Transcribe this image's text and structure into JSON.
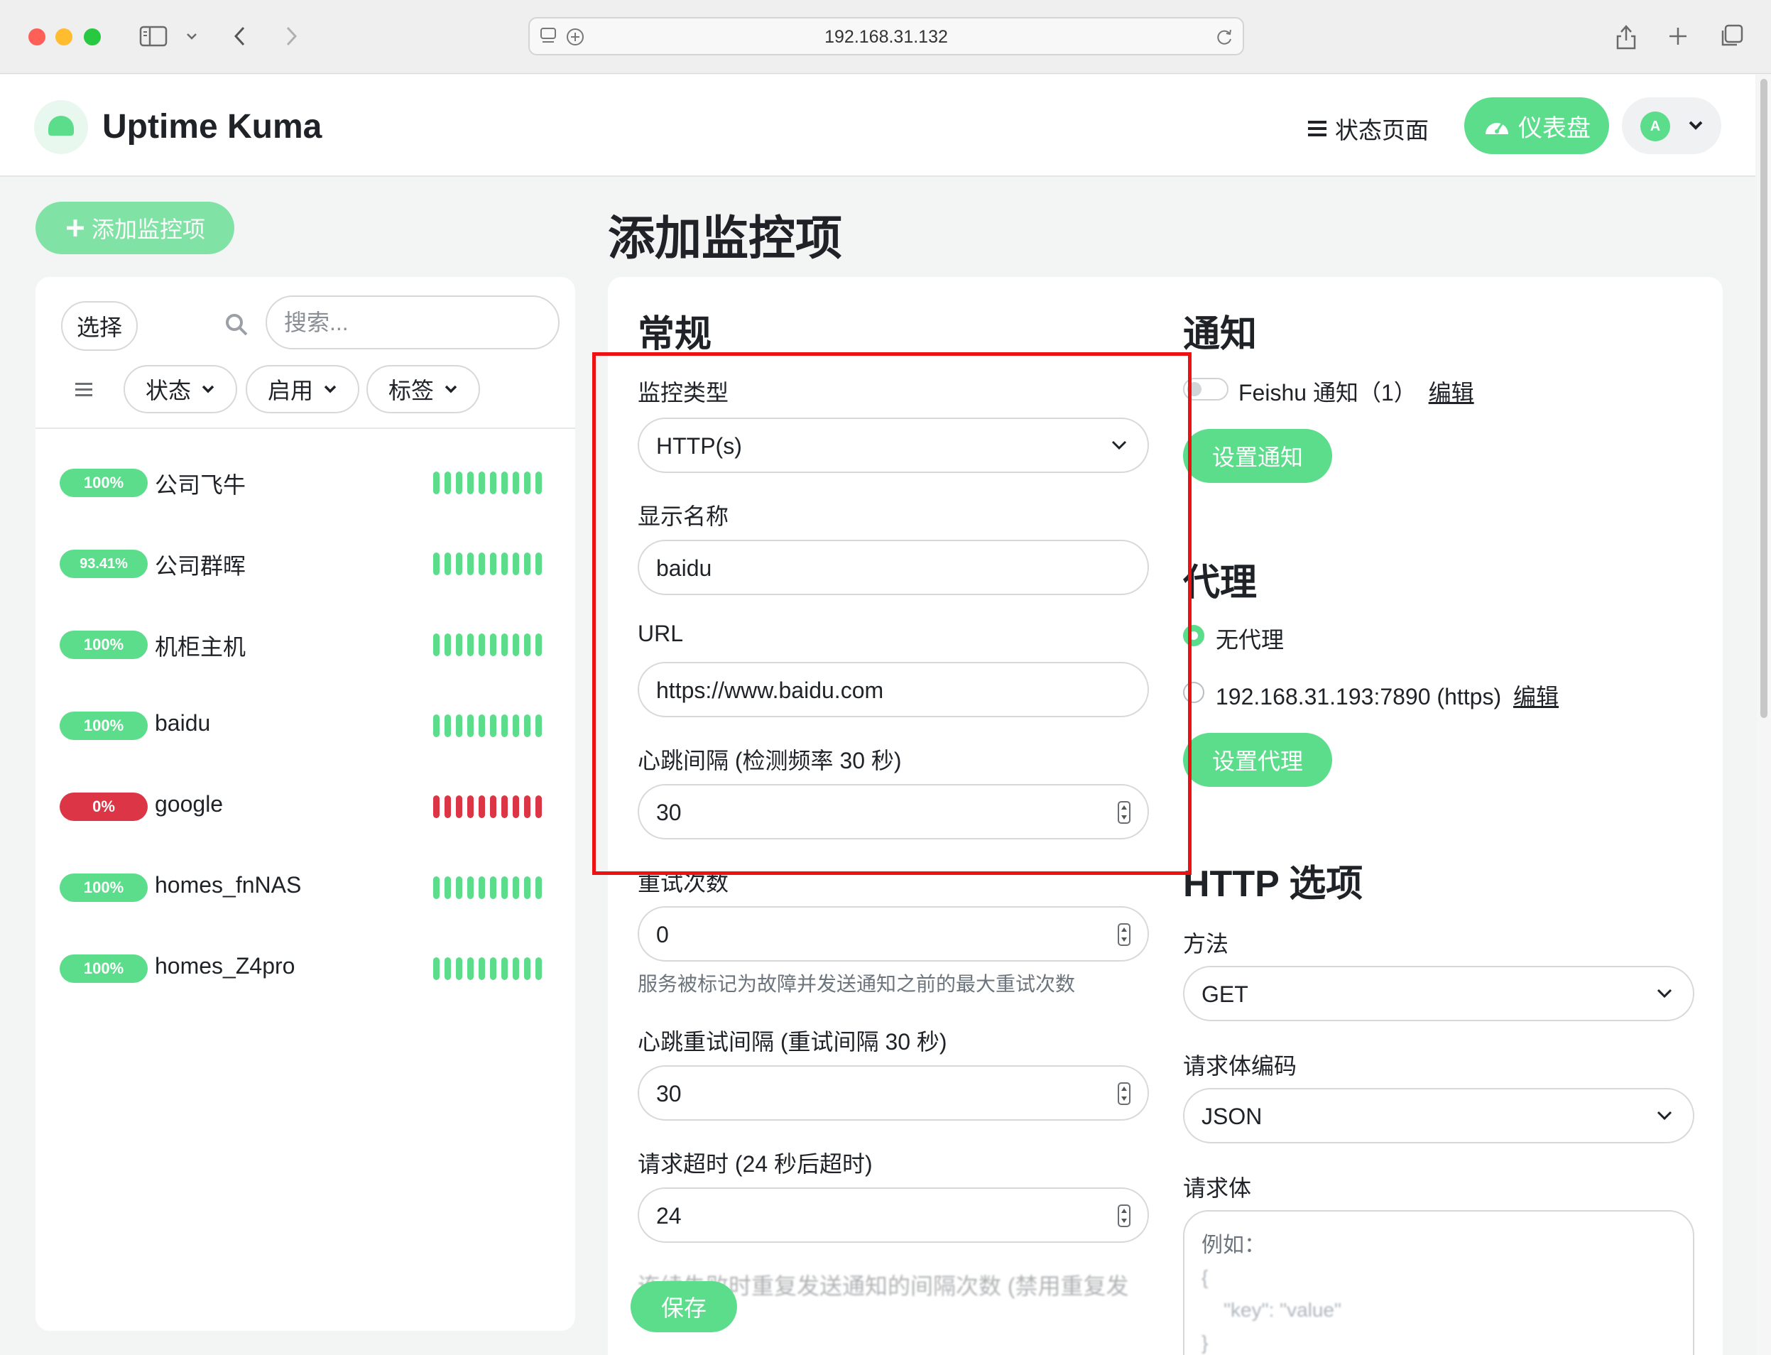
{
  "browser": {
    "url": "192.168.31.132"
  },
  "header": {
    "brand": "Uptime Kuma",
    "status_page_label": "状态页面",
    "dashboard_label": "仪表盘",
    "avatar_letter": "A"
  },
  "sidebar": {
    "add_button_label": "添加监控项",
    "select_label": "选择",
    "search_placeholder": "搜索...",
    "filters": [
      "状态",
      "启用",
      "标签"
    ],
    "monitors": [
      {
        "uptime": "100%",
        "name": "公司飞牛",
        "status": "up"
      },
      {
        "uptime": "93.41%",
        "name": "公司群晖",
        "status": "up"
      },
      {
        "uptime": "100%",
        "name": "机柜主机",
        "status": "up"
      },
      {
        "uptime": "100%",
        "name": "baidu",
        "status": "up"
      },
      {
        "uptime": "0%",
        "name": "google",
        "status": "down"
      },
      {
        "uptime": "100%",
        "name": "homes_fnNAS",
        "status": "up"
      },
      {
        "uptime": "100%",
        "name": "homes_Z4pro",
        "status": "up"
      }
    ],
    "colors": {
      "up": "#5cdd8b",
      "down": "#dc3545"
    }
  },
  "main": {
    "page_title": "添加监控项",
    "general": {
      "title": "常规",
      "monitor_type_label": "监控类型",
      "monitor_type_value": "HTTP(s)",
      "display_name_label": "显示名称",
      "display_name_value": "baidu",
      "url_label": "URL",
      "url_value": "https://www.baidu.com",
      "interval_label": "心跳间隔 (检测频率 30 秒)",
      "interval_value": "30",
      "retries_label": "重试次数",
      "retries_value": "0",
      "retries_hint": "服务被标记为故障并发送通知之前的最大重试次数",
      "retry_interval_label": "心跳重试间隔 (重试间隔 30 秒)",
      "retry_interval_value": "30",
      "timeout_label": "请求超时 (24 秒后超时)",
      "timeout_value": "24",
      "resend_label": "连续失败时重复发送通知的间隔次数 (禁用重复发",
      "save_label": "保存"
    },
    "notification": {
      "title": "通知",
      "item_label": "Feishu 通知（1）",
      "edit_label": "编辑",
      "setup_button": "设置通知"
    },
    "proxy": {
      "title": "代理",
      "no_proxy_label": "无代理",
      "proxy_item_label": "192.168.31.193:7890 (https)",
      "edit_label": "编辑",
      "setup_button": "设置代理"
    },
    "http_options": {
      "title": "HTTP 选项",
      "method_label": "方法",
      "method_value": "GET",
      "body_encoding_label": "请求体编码",
      "body_encoding_value": "JSON",
      "body_label": "请求体",
      "body_placeholder": "例如：",
      "body_example": "{\n    \"key\": \"value\"\n}"
    }
  }
}
